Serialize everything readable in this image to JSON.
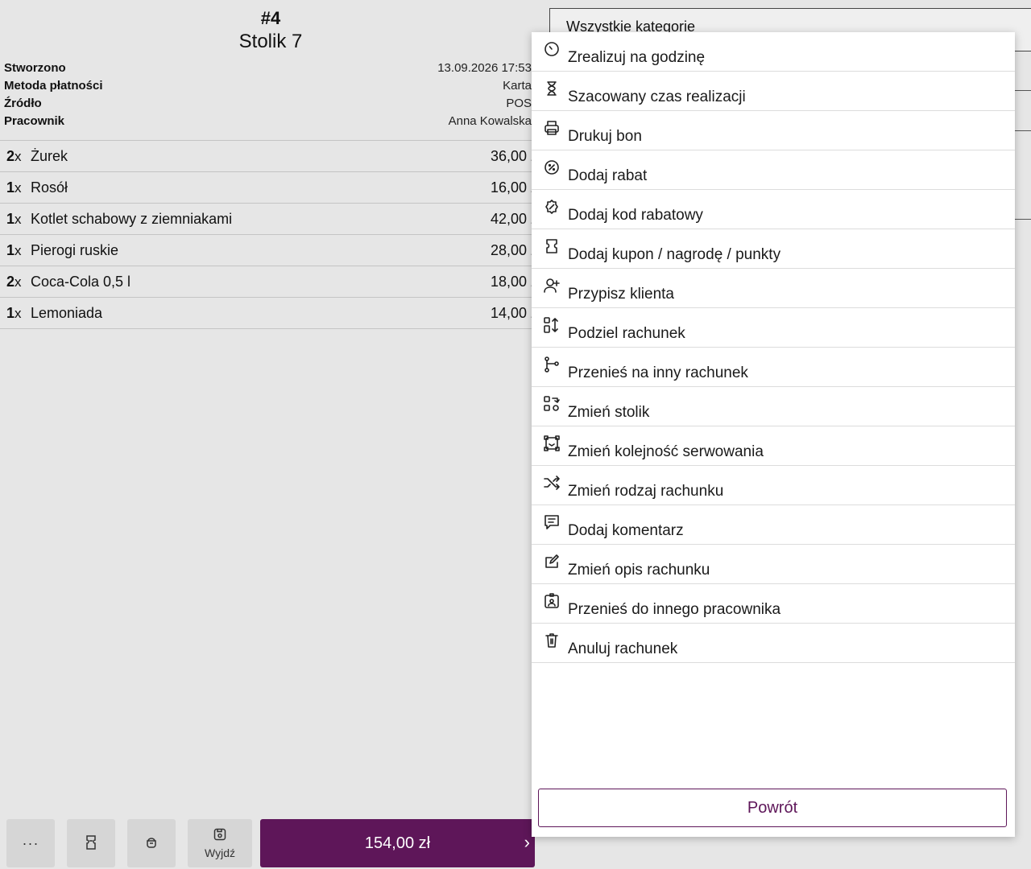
{
  "order": {
    "number": "#4",
    "table": "Stolik 7",
    "meta": [
      {
        "label": "Stworzono",
        "value": "13.09.2026 17:53"
      },
      {
        "label": "Metoda płatności",
        "value": "Karta"
      },
      {
        "label": "Źródło",
        "value": "POS"
      },
      {
        "label": "Pracownik",
        "value": "Anna Kowalska"
      }
    ],
    "items": [
      {
        "qty": "2",
        "x": "x",
        "name": "Żurek",
        "price": "36,00 zł"
      },
      {
        "qty": "1",
        "x": "x",
        "name": "Rosół",
        "price": "16,00 zł"
      },
      {
        "qty": "1",
        "x": "x",
        "name": "Kotlet schabowy z ziemniakami",
        "price": "42,00 zł"
      },
      {
        "qty": "1",
        "x": "x",
        "name": "Pierogi ruskie",
        "price": "28,00 zł"
      },
      {
        "qty": "2",
        "x": "x",
        "name": "Coca-Cola 0,5 l",
        "price": "18,00 zł"
      },
      {
        "qty": "1",
        "x": "x",
        "name": "Lemoniada",
        "price": "14,00 zł"
      }
    ]
  },
  "bottom_bar": {
    "more_label": "···",
    "exit_label": "Wyjdź",
    "pay_amount": "154,00 zł",
    "pay_chevron": "›",
    "accent": "#5e1659"
  },
  "categories": {
    "label": "Wszystkie kategorie"
  },
  "menu": {
    "items": [
      {
        "label": "Zrealizuj na godzinę",
        "icon": "clock-icon"
      },
      {
        "label": "Szacowany czas realizacji",
        "icon": "hourglass-icon"
      },
      {
        "label": "Drukuj bon",
        "icon": "printer-icon"
      },
      {
        "label": "Dodaj rabat",
        "icon": "discount-icon"
      },
      {
        "label": "Dodaj kod rabatowy",
        "icon": "discount-code-icon"
      },
      {
        "label": "Dodaj kupon / nagrodę / punkty",
        "icon": "coupon-icon"
      },
      {
        "label": "Przypisz klienta",
        "icon": "user-plus-icon"
      },
      {
        "label": "Podziel rachunek",
        "icon": "split-icon"
      },
      {
        "label": "Przenieś na inny rachunek",
        "icon": "git-branch-icon"
      },
      {
        "label": "Zmień stolik",
        "icon": "swap-table-icon"
      },
      {
        "label": "Zmień kolejność serwowania",
        "icon": "order-sequence-icon"
      },
      {
        "label": "Zmień rodzaj rachunku",
        "icon": "shuffle-icon"
      },
      {
        "label": "Dodaj komentarz",
        "icon": "comment-icon"
      },
      {
        "label": "Zmień opis rachunku",
        "icon": "edit-note-icon"
      },
      {
        "label": "Przenieś do innego pracownika",
        "icon": "employee-badge-icon"
      },
      {
        "label": "Anuluj rachunek",
        "icon": "trash-icon"
      }
    ],
    "back_label": "Powrót"
  }
}
